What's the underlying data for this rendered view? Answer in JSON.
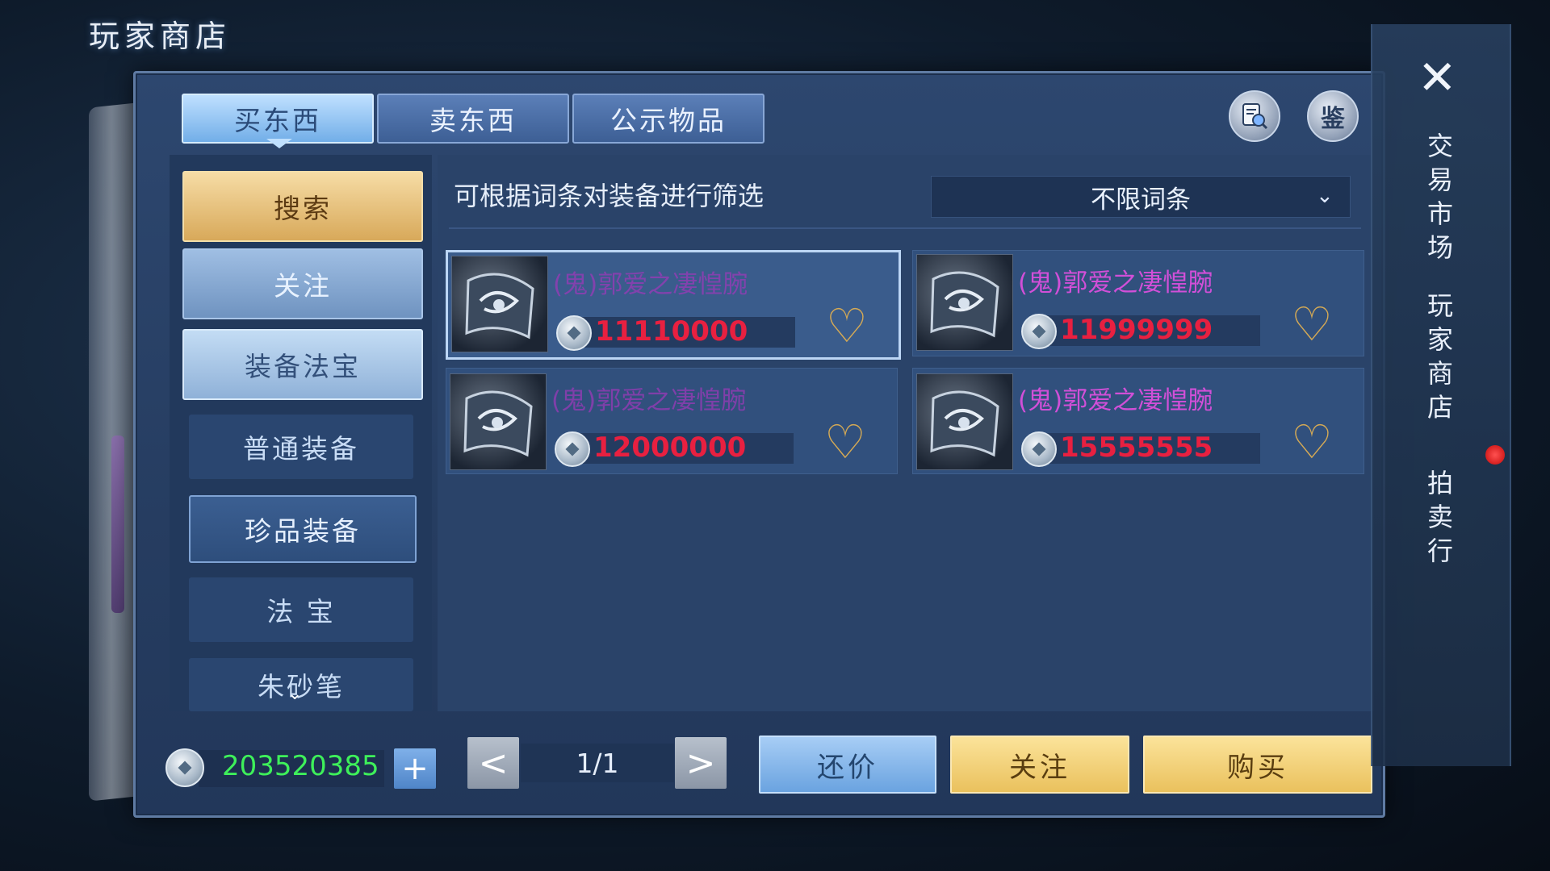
{
  "title": "玩家商店",
  "tabs": [
    {
      "label": "买东西",
      "active": true
    },
    {
      "label": "卖东西",
      "active": false
    },
    {
      "label": "公示物品",
      "active": false
    }
  ],
  "top_buttons": {
    "search_icon": "magnifier-scroll-icon",
    "appraise_label": "鉴"
  },
  "sidebar": {
    "items": [
      {
        "label": "搜索"
      },
      {
        "label": "关注"
      },
      {
        "label": "装备法宝"
      },
      {
        "label": "普通装备"
      },
      {
        "label": "珍品装备"
      },
      {
        "label": "法 宝"
      },
      {
        "label": "朱砂笔"
      }
    ]
  },
  "filter": {
    "hint": "可根据词条对装备进行筛选",
    "selected": "不限词条"
  },
  "listings": [
    {
      "name": "(鬼)郭爱之凄惶腕",
      "price": "11110000",
      "selected": true
    },
    {
      "name": "(鬼)郭爱之凄惶腕",
      "price": "11999999",
      "selected": false
    },
    {
      "name": "(鬼)郭爱之凄惶腕",
      "price": "12000000",
      "selected": false
    },
    {
      "name": "(鬼)郭爱之凄惶腕",
      "price": "15555555",
      "selected": false
    }
  ],
  "bottom": {
    "money": "203520385",
    "plus": "+",
    "prev": "<",
    "next": ">",
    "page": "1/1",
    "bargain": "还价",
    "follow": "关注",
    "buy": "购买"
  },
  "right_nav": {
    "close": "✕",
    "items": [
      "交易市场",
      "玩家商店",
      "拍卖行"
    ]
  },
  "colors": {
    "price_red": "#e82040",
    "money_green": "#3ef05a",
    "name_purple": "#d14fd8",
    "gold": "#eac15d"
  }
}
